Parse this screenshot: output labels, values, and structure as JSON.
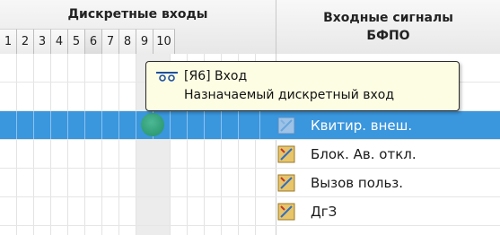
{
  "header": {
    "group_title": "Дискретные входы",
    "columns": [
      "1",
      "2",
      "3",
      "4",
      "5",
      "6",
      "7",
      "8",
      "9",
      "10"
    ],
    "signals_title_line1": "Входные сигналы",
    "signals_title_line2": "БФПО"
  },
  "tooltip": {
    "icon": "contact-icon",
    "title": "[Я6] Вход",
    "description": "Назначаемый дискретный вход"
  },
  "rows": [
    {
      "signal": "",
      "selected": false
    },
    {
      "signal": "",
      "selected": false
    },
    {
      "signal": "Квитир. внеш.",
      "selected": true,
      "assigned_input": "6"
    },
    {
      "signal": "Блок. Ав. откл.",
      "selected": false
    },
    {
      "signal": "Вызов польз.",
      "selected": false
    },
    {
      "signal": "ДгЗ",
      "selected": false
    }
  ],
  "colors": {
    "selection": "#3a96dd",
    "assigned_dot": "#2ea57a",
    "tooltip_bg": "#fdfde3"
  }
}
